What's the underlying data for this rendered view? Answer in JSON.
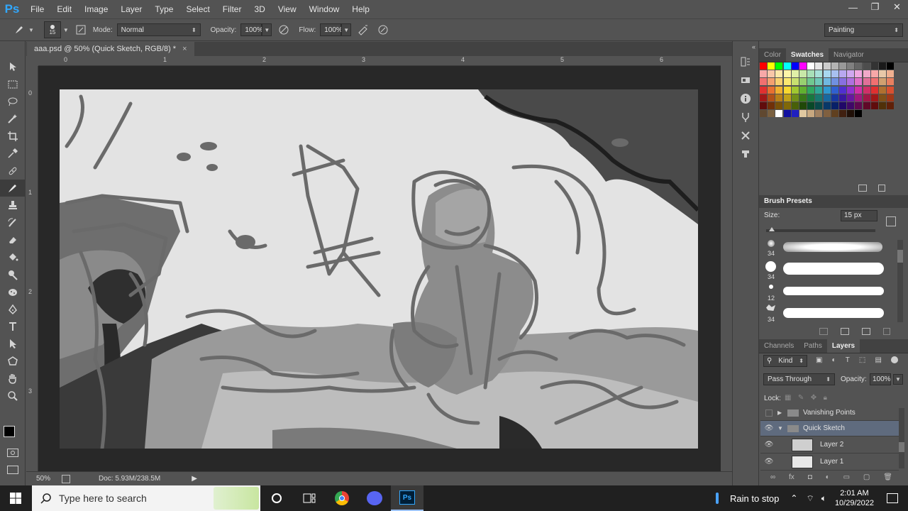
{
  "app": {
    "logo": "Ps"
  },
  "menu": [
    "File",
    "Edit",
    "Image",
    "Layer",
    "Type",
    "Select",
    "Filter",
    "3D",
    "View",
    "Window",
    "Help"
  ],
  "window_controls": {
    "minimize": "—",
    "restore": "❐",
    "close": "✕"
  },
  "options": {
    "brush_size": "15",
    "mode_label": "Mode:",
    "mode_value": "Normal",
    "opacity_label": "Opacity:",
    "opacity_value": "100%",
    "flow_label": "Flow:",
    "flow_value": "100%",
    "workspace": "Painting"
  },
  "document": {
    "tab_title": "aaa.psd @ 50% (Quick Sketch, RGB/8) *",
    "tab_close": "×",
    "zoom": "50%",
    "doc_info": "Doc: 5.93M/238.5M"
  },
  "rulers": {
    "top": [
      "0",
      "1",
      "2",
      "3",
      "4",
      "5",
      "6"
    ],
    "left": [
      "0",
      "1",
      "2",
      "3"
    ]
  },
  "panels": {
    "color_tabs": [
      "Color",
      "Swatches",
      "Navigator"
    ],
    "active_color_tab": "Swatches",
    "brush_presets_title": "Brush Presets",
    "size_label": "Size:",
    "size_value": "15 px",
    "brushes": [
      {
        "size": "34"
      },
      {
        "size": "34"
      },
      {
        "size": "12"
      },
      {
        "size": "34"
      }
    ],
    "layers_tabs": [
      "Channels",
      "Paths",
      "Layers"
    ],
    "active_layers_tab": "Layers",
    "kind_label": "Kind",
    "blend_mode": "Pass Through",
    "layer_opacity_label": "Opacity:",
    "layer_opacity_value": "100%",
    "lock_label": "Lock:",
    "layers": [
      {
        "name": "Vanishing Points",
        "type": "group",
        "expanded": false,
        "visible": false
      },
      {
        "name": "Quick Sketch",
        "type": "group",
        "expanded": true,
        "visible": true,
        "selected": true
      },
      {
        "name": "Layer 2",
        "type": "layer",
        "visible": true
      },
      {
        "name": "Layer 1",
        "type": "layer",
        "visible": true
      }
    ]
  },
  "swatch_colors": [
    "#ff0000",
    "#ffff00",
    "#00ff00",
    "#00ffff",
    "#0000ff",
    "#ff00ff",
    "#ffffff",
    "#e6e6e6",
    "#cccccc",
    "#b3b3b3",
    "#999999",
    "#808080",
    "#666666",
    "#4d4d4d",
    "#333333",
    "#1a1a1a",
    "#000000",
    "#ff8a80"
  ],
  "taskbar": {
    "search_placeholder": "Type here to search",
    "weather": "Rain to stop",
    "time": "2:01 AM",
    "date": "10/29/2022"
  }
}
